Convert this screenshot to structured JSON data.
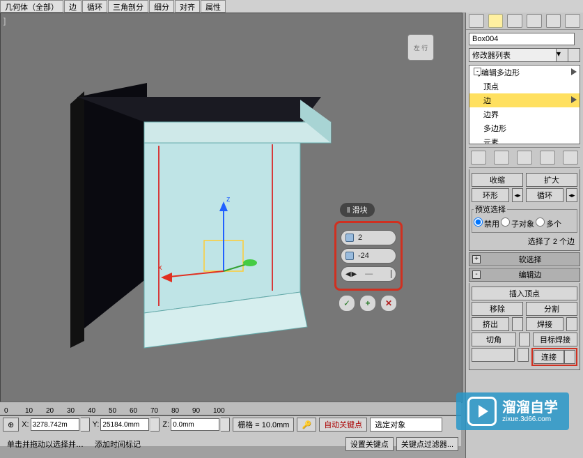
{
  "toolbar": {
    "items": [
      "几何体（全部）",
      "边",
      "循环",
      "三角剖分",
      "细分",
      "对齐",
      "属性"
    ]
  },
  "viewport": {
    "corner": "]",
    "cube": "左 行"
  },
  "caddy": {
    "title": "‖ 滑块",
    "segments": "2",
    "pinch": "-24",
    "slide": ""
  },
  "panel": {
    "object_name": "Box004",
    "modifier_list": "修改器列表",
    "stack": [
      {
        "label": "可编辑多边形",
        "top": true,
        "exp": "-",
        "tri": true
      },
      {
        "label": "顶点"
      },
      {
        "label": "边",
        "sel": true,
        "tri": true
      },
      {
        "label": "边界"
      },
      {
        "label": "多边形"
      },
      {
        "label": "元素"
      }
    ],
    "sel": {
      "shrink": "收缩",
      "grow": "扩大",
      "ring": "环形",
      "loop": "循环",
      "preview": "预览选择",
      "off": "禁用",
      "subobj": "子对象",
      "multi": "多个",
      "status": "选择了 2 个边"
    },
    "soft": "软选择",
    "edit_edge": {
      "title": "编辑边",
      "insert": "插入顶点",
      "remove": "移除",
      "split": "分割",
      "extrude": "挤出",
      "weld": "焊接",
      "chamfer": "切角",
      "target": "目标焊接",
      "connect": "连接"
    }
  },
  "bottom": {
    "ticks": [
      "0",
      "10",
      "20",
      "30",
      "40",
      "50",
      "60",
      "70",
      "80",
      "90",
      "100"
    ],
    "x_label": "X:",
    "x": "3278.742m",
    "y_label": "Y:",
    "y": "25184.0mm",
    "z_label": "Z:",
    "z": "0.0mm",
    "grid_label": "栅格 = 10.0mm",
    "autokey": "自动关键点",
    "selected": "选定对象",
    "setkey": "设置关键点",
    "keyfilter": "关键点过滤器...",
    "addtime": "添加时间标记",
    "hint": "单击并拖动以选择并…"
  },
  "watermark": {
    "brand": "溜溜自学",
    "url": "zixue.3d66.com"
  }
}
